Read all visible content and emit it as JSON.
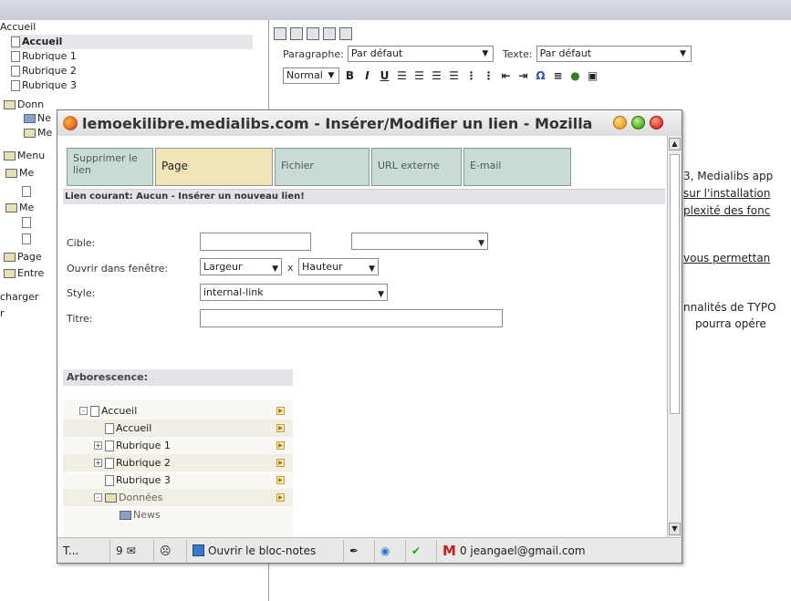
{
  "left_tree": {
    "items": [
      {
        "label": "Accueil",
        "bold": false,
        "icon": "none"
      },
      {
        "label": "Accueil",
        "bold": true,
        "icon": "page-icon"
      },
      {
        "label": "Rubrique 1",
        "bold": false,
        "icon": "page-icon"
      },
      {
        "label": "Rubrique 2",
        "bold": false,
        "icon": "page-icon"
      },
      {
        "label": "Rubrique 3",
        "bold": false,
        "icon": "page-icon"
      },
      {
        "label": "Donn",
        "bold": false,
        "icon": "folder-icon"
      },
      {
        "label": "Ne",
        "bold": false,
        "icon": "news-icon"
      },
      {
        "label": "Me",
        "bold": false,
        "icon": "folder-icon"
      },
      {
        "label": "Menu",
        "bold": false,
        "icon": "folder-icon"
      },
      {
        "label": "Me",
        "bold": false,
        "icon": "folder-icon"
      },
      {
        "label": "",
        "bold": false,
        "icon": "page-icon"
      },
      {
        "label": "Me",
        "bold": false,
        "icon": "folder-icon"
      },
      {
        "label": "",
        "bold": false,
        "icon": "page-icon"
      },
      {
        "label": "",
        "bold": false,
        "icon": "page-icon"
      },
      {
        "label": "Page",
        "bold": false,
        "icon": "folder-icon"
      },
      {
        "label": "Entre",
        "bold": false,
        "icon": "folder-icon"
      },
      {
        "label": "charger",
        "bold": false,
        "icon": "none"
      },
      {
        "label": "r",
        "bold": false,
        "icon": "none"
      }
    ]
  },
  "editor": {
    "paragraphe_label": "Paragraphe:",
    "paragraphe_value": "Par défaut",
    "texte_label": "Texte:",
    "texte_value": "Par défaut",
    "style_value": "Normal",
    "format_buttons": [
      "B",
      "I",
      "U"
    ]
  },
  "editor_text": {
    "lines": [
      "3, Medialibs app",
      "sur l'installation",
      "plexité des fonc",
      "vous permettan",
      "nnalités de TYPO",
      "pourra opére"
    ]
  },
  "popup": {
    "title": "lemoekilibre.medialibs.com - Insérer/Modifier un lien - Mozilla",
    "tabs": [
      {
        "label": "Supprimer le lien",
        "active": false
      },
      {
        "label": "Page",
        "active": true
      },
      {
        "label": "Fichier",
        "active": false
      },
      {
        "label": "URL externe",
        "active": false
      },
      {
        "label": "E-mail",
        "active": false
      }
    ],
    "current_link": "Lien courant: Aucun - Insérer un nouveau lien!",
    "form": {
      "cible_label": "Cible:",
      "cible_value": "",
      "cible_select": "",
      "ouvrir_label": "Ouvrir dans fenêtre:",
      "largeur": "Largeur",
      "x_sep": "x",
      "hauteur": "Hauteur",
      "style_label": "Style:",
      "style_value": "internal-link",
      "titre_label": "Titre:",
      "titre_value": ""
    },
    "arborescence": {
      "heading": "Arborescence:",
      "rows": [
        {
          "label": "Accueil",
          "indent": 0,
          "toggle": "-",
          "icon": "root-page-icon"
        },
        {
          "label": "Accueil",
          "indent": 1,
          "toggle": "",
          "icon": "page-icon"
        },
        {
          "label": "Rubrique 1",
          "indent": 1,
          "toggle": "+",
          "icon": "page-icon"
        },
        {
          "label": "Rubrique 2",
          "indent": 1,
          "toggle": "+",
          "icon": "page-icon"
        },
        {
          "label": "Rubrique 3",
          "indent": 1,
          "toggle": "",
          "icon": "page-icon"
        },
        {
          "label": "Données",
          "indent": 1,
          "toggle": "-",
          "icon": "folder-icon"
        },
        {
          "label": "News",
          "indent": 2,
          "toggle": "",
          "icon": "news-icon"
        }
      ]
    },
    "statusbar": {
      "t_label": "T...",
      "mail_count": "9",
      "notes_label": "Ouvrir le bloc-notes",
      "gmail_label": "0 jeangael@gmail.com"
    }
  }
}
